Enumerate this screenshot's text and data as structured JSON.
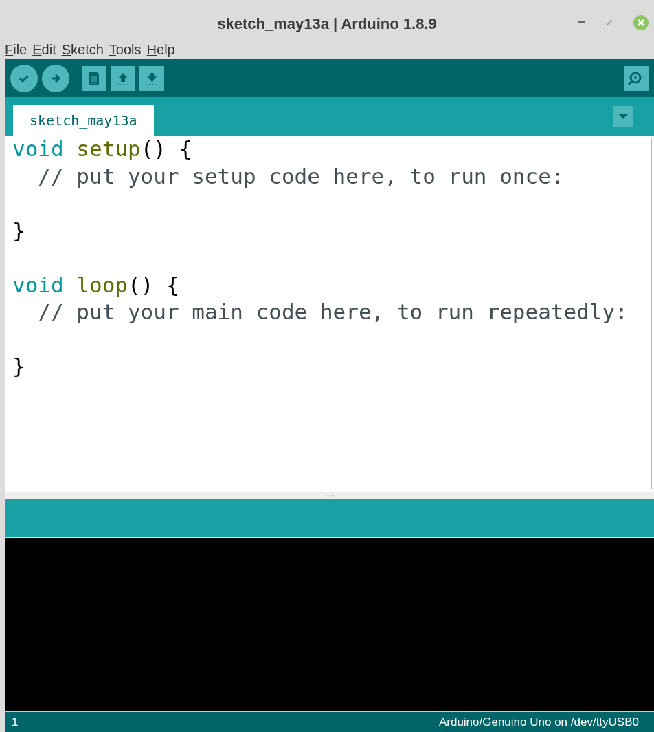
{
  "window": {
    "title": "sketch_may13a | Arduino 1.8.9"
  },
  "menu": [
    "File",
    "Edit",
    "Sketch",
    "Tools",
    "Help"
  ],
  "tabs": [
    {
      "label": "sketch_may13a",
      "selected": true
    }
  ],
  "code": [
    {
      "blank_after": false,
      "tokens": [
        {
          "kind": "keyword",
          "text": "void"
        },
        {
          "kind": "function",
          "text": "setup"
        },
        {
          "kind": "plain",
          "text": "() {"
        }
      ]
    },
    {
      "blank_after": true,
      "tokens": [
        {
          "kind": "comment",
          "text": "// put your setup code here, to run once:"
        }
      ]
    },
    {
      "blank_after": true,
      "tokens": [
        {
          "kind": "plain",
          "text": "}"
        }
      ]
    },
    {
      "blank_after": false,
      "tokens": [
        {
          "kind": "keyword",
          "text": "void"
        },
        {
          "kind": "function",
          "text": "loop"
        },
        {
          "kind": "plain",
          "text": "() {"
        }
      ]
    },
    {
      "blank_after": true,
      "tokens": [
        {
          "kind": "comment",
          "text": "// put your main code here, to run repeatedly:"
        }
      ]
    },
    {
      "blank_after": false,
      "tokens": [
        {
          "kind": "plain",
          "text": "}"
        }
      ]
    }
  ],
  "status_bar": {
    "line": "1",
    "board": "Arduino/Genuino Uno on /dev/ttyUSB0"
  }
}
